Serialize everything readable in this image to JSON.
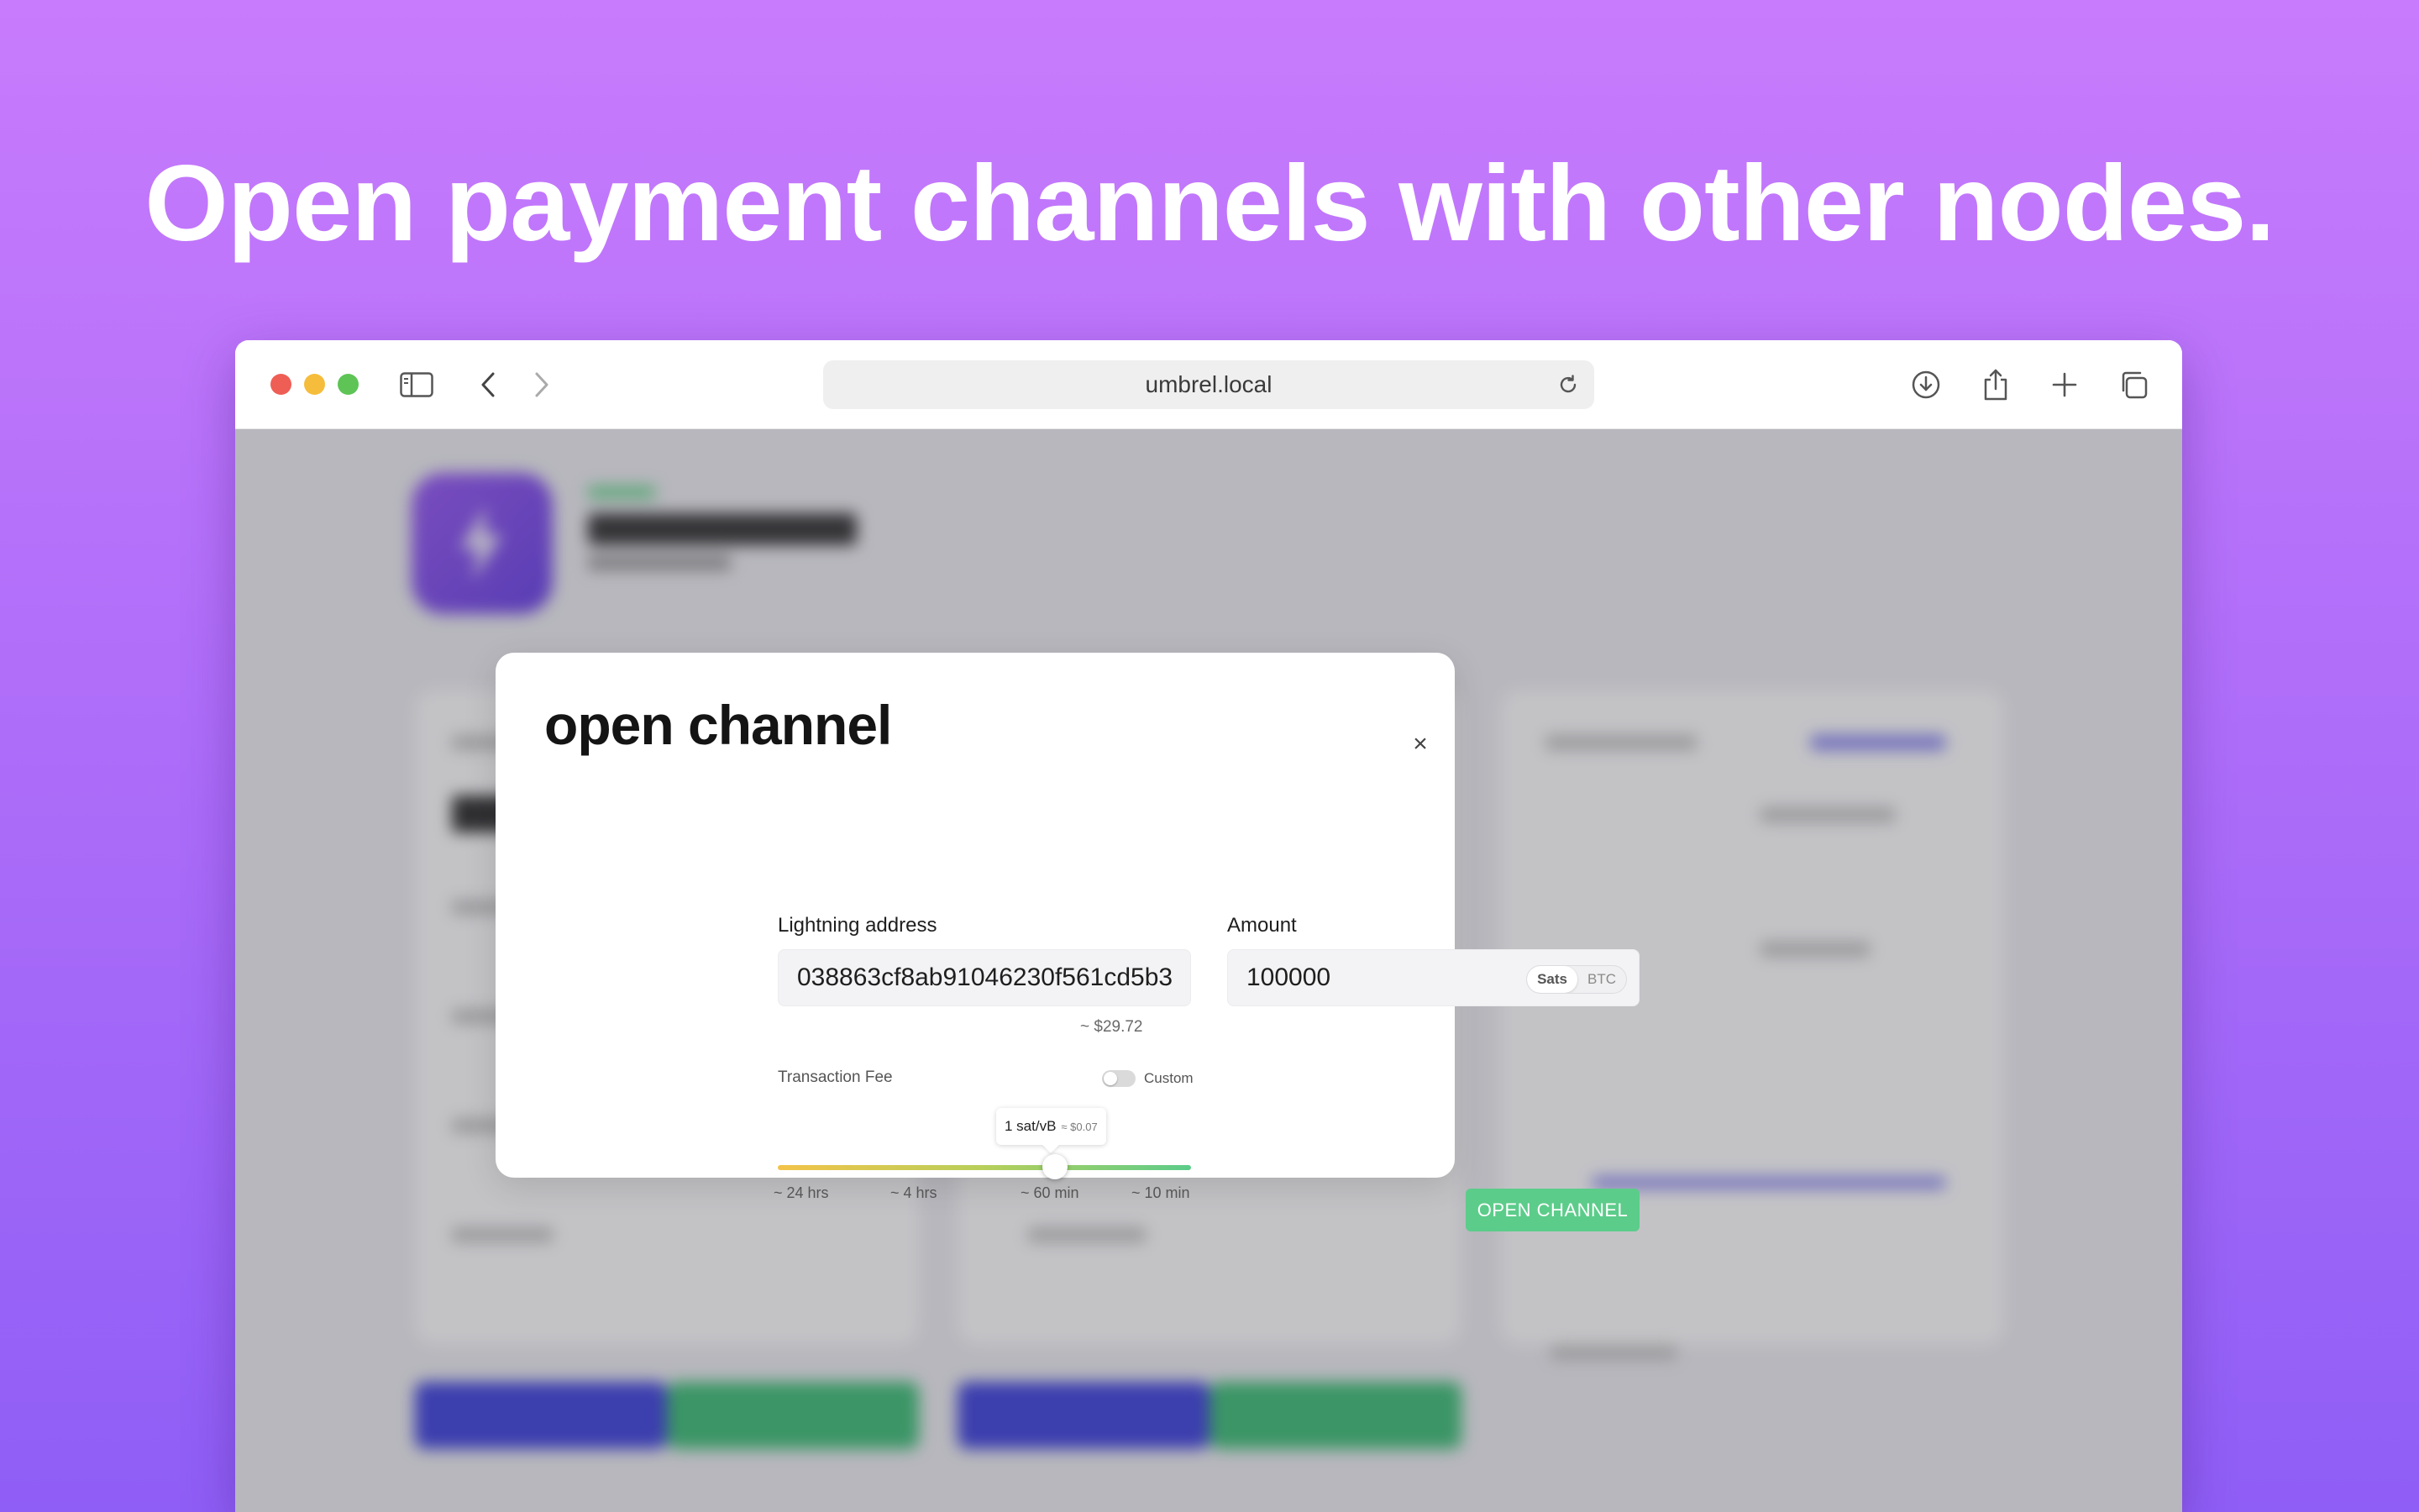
{
  "headline": "Open payment channels with other nodes.",
  "browser": {
    "url": "umbrel.local",
    "icons": [
      "sidebar-icon",
      "back-icon",
      "forward-icon",
      "reload-icon",
      "download-icon",
      "share-icon",
      "new-tab-icon",
      "tabs-overview-icon"
    ]
  },
  "modal": {
    "title": "open channel",
    "close_symbol": "×",
    "address_label": "Lightning address",
    "address_value": "038863cf8ab91046230f561cd5b3",
    "amount_label": "Amount",
    "amount_value": "100000",
    "unit_options": [
      "Sats",
      "BTC"
    ],
    "unit_selected": "Sats",
    "fiat_estimate": "~ $29.72",
    "fee_label": "Transaction Fee",
    "custom_label": "Custom",
    "custom_enabled": false,
    "fee_rate": "1 sat/vB",
    "fee_usd": "≈ $0.07",
    "fee_ticks": [
      "~ 24 hrs",
      "~ 4 hrs",
      "~ 60 min",
      "~ 10 min"
    ],
    "fee_slider_fraction": 0.67,
    "open_button": "OPEN CHANNEL"
  },
  "colors": {
    "accent_green": "#5ccc8a",
    "background_top": "#c87bfc",
    "background_bottom": "#8f5ef6"
  }
}
